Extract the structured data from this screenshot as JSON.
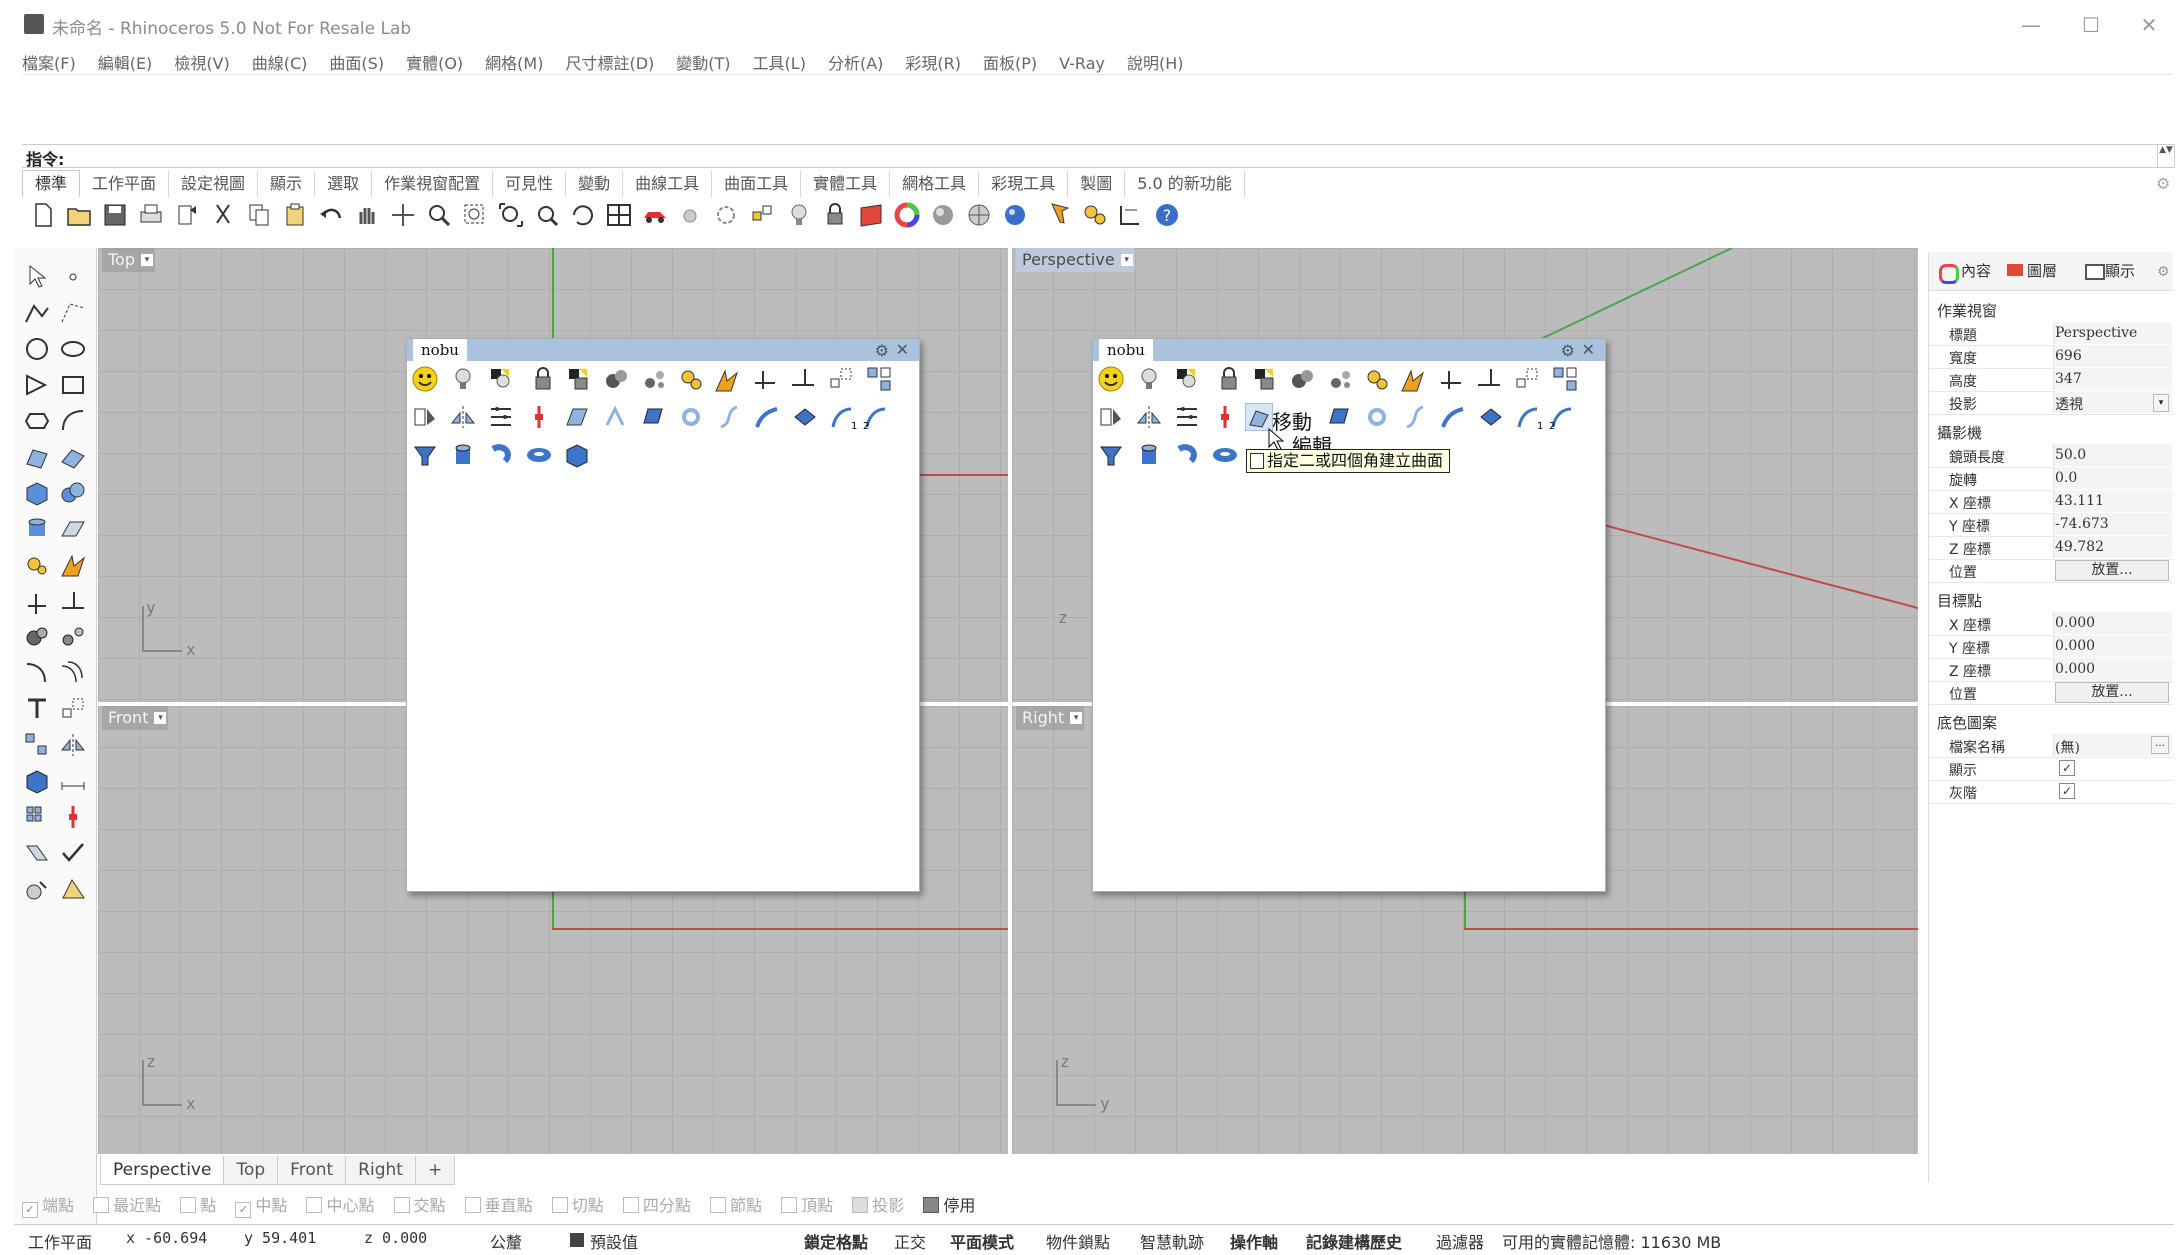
{
  "window": {
    "title": "未命名 - Rhinoceros 5.0 Not For Resale Lab",
    "minimize": "—",
    "maximize": "☐",
    "close": "✕"
  },
  "menu": [
    "檔案(F)",
    "編輯(E)",
    "檢視(V)",
    "曲線(C)",
    "曲面(S)",
    "實體(O)",
    "網格(M)",
    "尺寸標註(D)",
    "變動(T)",
    "工具(L)",
    "分析(A)",
    "彩現(R)",
    "面板(P)",
    "V-Ray",
    "說明(H)"
  ],
  "command": {
    "label": "指令:"
  },
  "toolbar_tabs": [
    "標準",
    "工作平面",
    "設定視圖",
    "顯示",
    "選取",
    "作業視窗配置",
    "可見性",
    "變動",
    "曲線工具",
    "曲面工具",
    "實體工具",
    "網格工具",
    "彩現工具",
    "製圖",
    "5.0 的新功能"
  ],
  "toolbar_tabs_active": 0,
  "icons": {
    "main_toolbar": [
      "new-file-icon",
      "open-folder-icon",
      "save-icon",
      "print-icon",
      "import-icon",
      "cut-icon",
      "copy-icon",
      "paste-icon",
      "undo-icon",
      "pan-hand-icon",
      "move-view-icon",
      "zoom-icon",
      "zoom-window-icon",
      "zoom-extents-icon",
      "zoom-selected-icon",
      "rotate-view-icon",
      "four-viewports-icon",
      "car-icon",
      "select-icon",
      "circle-dash-icon",
      "transform-icon",
      "lightbulb-icon",
      "lock-icon",
      "layer-icon",
      "color-wheel-icon",
      "sphere-gray-icon",
      "sphere-white-icon",
      "sphere-blue-icon",
      "flag-icon",
      "gear-group-icon",
      "dimension-icon",
      "help-icon"
    ]
  },
  "viewports": {
    "top": {
      "label": "Top",
      "axis_a": "y",
      "axis_b": "x"
    },
    "perspective": {
      "label": "Perspective",
      "axis_a": "z"
    },
    "front": {
      "label": "Front",
      "axis_a": "z",
      "axis_b": "x"
    },
    "right": {
      "label": "Right",
      "axis_a": "z",
      "axis_b": "y"
    }
  },
  "colors": {
    "grid_bg": "#bcbcbc",
    "x_axis": "#c24a4a",
    "y_axis": "#4aa64a",
    "nobu_header": "#a9c2de"
  },
  "nobu_panel": {
    "title": "nobu"
  },
  "context_menu": {
    "move": "移動",
    "edit": "編輯"
  },
  "tooltip": {
    "text": "指定二或四個角建立曲面"
  },
  "bottom_tabs": [
    "Perspective",
    "Top",
    "Front",
    "Right",
    "+"
  ],
  "osnap": {
    "items": [
      "端點",
      "最近點",
      "點",
      "中點",
      "中心點",
      "交點",
      "垂直點",
      "切點",
      "四分點",
      "節點",
      "頂點",
      "投影"
    ],
    "checked": [
      true,
      false,
      false,
      true,
      false,
      false,
      false,
      false,
      false,
      false,
      false,
      false
    ],
    "disable": "停用"
  },
  "status": {
    "cplane": "工作平面",
    "x": "x -60.694",
    "y": "y 59.401",
    "z": "z 0.000",
    "unit": "公釐",
    "layer": "預設值",
    "grid_snap": "鎖定格點",
    "ortho": "正交",
    "planar": "平面模式",
    "osnap": "物件鎖點",
    "smarttrack": "智慧軌跡",
    "gumball": "操作軸",
    "history": "記錄建構歷史",
    "filter": "過濾器",
    "memory": "可用的實體記憶體: 11630 MB"
  },
  "properties": {
    "tabs": [
      "內容",
      "圖層",
      "顯示"
    ],
    "section_viewport": "作業視窗",
    "title_label": "標題",
    "title_value": "Perspective",
    "width_label": "寬度",
    "width_value": "696",
    "height_label": "高度",
    "height_value": "347",
    "projection_label": "投影",
    "projection_value": "透視",
    "section_camera": "攝影機",
    "lens_label": "鏡頭長度",
    "lens_value": "50.0",
    "rotation_label": "旋轉",
    "rotation_value": "0.0",
    "cam_x_label": "X 座標",
    "cam_x_value": "43.111",
    "cam_y_label": "Y 座標",
    "cam_y_value": "-74.673",
    "cam_z_label": "Z 座標",
    "cam_z_value": "49.782",
    "cam_pos_label": "位置",
    "cam_pos_button": "放置...",
    "section_target": "目標點",
    "tgt_x_label": "X 座標",
    "tgt_x_value": "0.000",
    "tgt_y_label": "Y 座標",
    "tgt_y_value": "0.000",
    "tgt_z_label": "Z 座標",
    "tgt_z_value": "0.000",
    "tgt_pos_label": "位置",
    "tgt_pos_button": "放置...",
    "section_wallpaper": "底色圖案",
    "filename_label": "檔案名稱",
    "filename_value": "(無)",
    "show_label": "顯示",
    "show_checked": true,
    "gray_label": "灰階",
    "gray_checked": true
  }
}
